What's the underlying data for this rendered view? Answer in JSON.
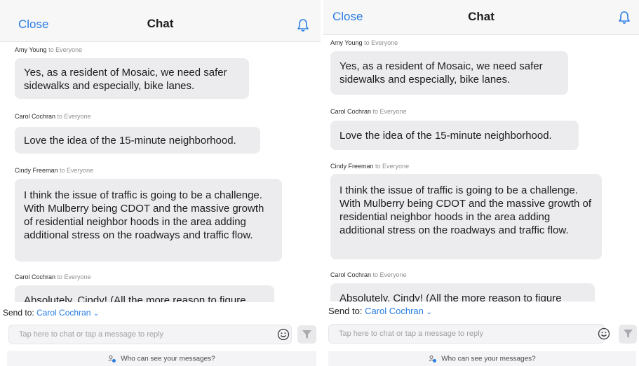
{
  "header": {
    "close_label": "Close",
    "title": "Chat",
    "bell_icon": "bell-icon"
  },
  "messages": [
    {
      "sender": "Amy Young",
      "to": "to Everyone",
      "text": "Yes, as a resident of Mosaic, we need safer sidewalks and especially, bike lanes."
    },
    {
      "sender": "Carol Cochran",
      "to": "to Everyone",
      "text": "Love the idea of the 15-minute neighborhood."
    },
    {
      "sender": "Cindy Freeman",
      "to": "to Everyone",
      "text": "I think the issue of traffic is going to be a challenge. With Mulberry being CDOT and the massive growth of residential neighbor hoods in the area adding additional stress on the roadways and traffic flow."
    },
    {
      "sender": "Carol Cochran",
      "to": "to Everyone",
      "text": "Absolutely. Cindy!  (All the more reason to figure"
    }
  ],
  "composer": {
    "send_to_label": "Send to:",
    "recipient": "Carol Cochran",
    "chevron": "⌄",
    "placeholder": "Tap here to chat or tap a message to reply",
    "emoji_icon": "smiley-icon",
    "send_icon": "send-filter-icon"
  },
  "footer": {
    "who_can_see": "Who can see your messages?"
  },
  "colors": {
    "accent": "#2a7de1",
    "bubble": "#ececef",
    "header_bg": "#f7f7f8"
  }
}
